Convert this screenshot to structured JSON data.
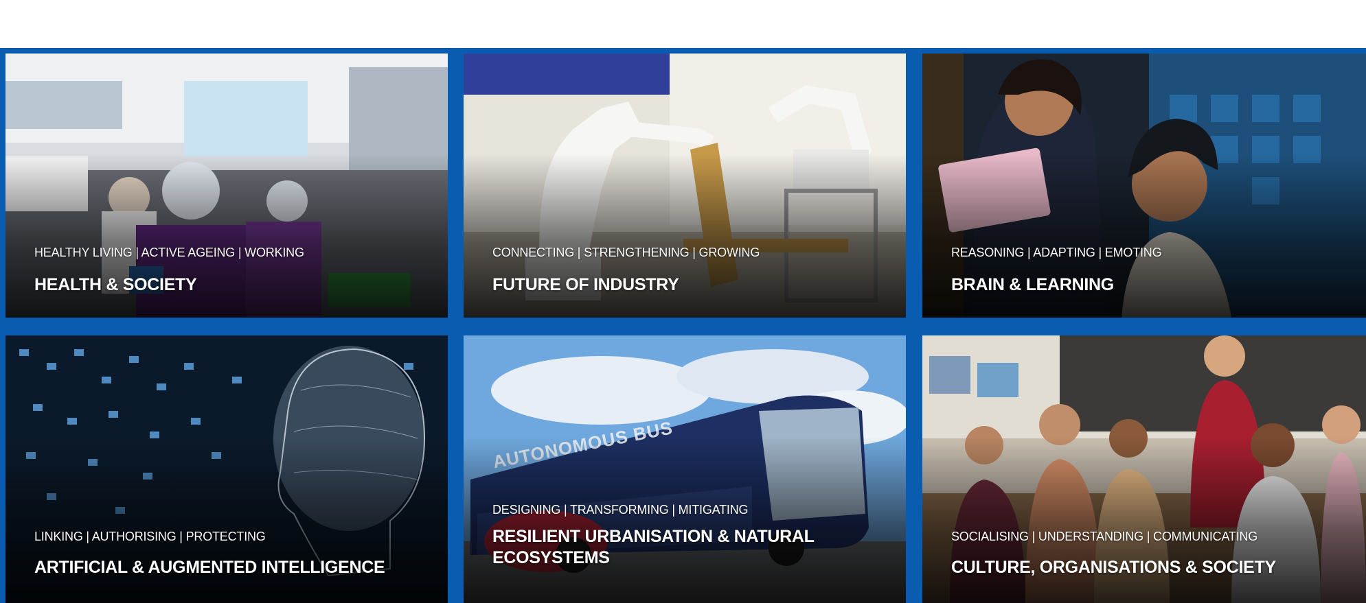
{
  "tiles": [
    {
      "subtitle": "HEALTHY LIVING | ACTIVE AGEING | WORKING",
      "title": "HEALTH & SOCIETY"
    },
    {
      "subtitle": "CONNECTING | STRENGTHENING | GROWING",
      "title": "FUTURE OF INDUSTRY"
    },
    {
      "subtitle": "REASONING | ADAPTING | EMOTING",
      "title": "BRAIN & LEARNING"
    },
    {
      "subtitle": "LINKING | AUTHORISING | PROTECTING",
      "title": "ARTIFICIAL & AUGMENTED INTELLIGENCE"
    },
    {
      "subtitle": "DESIGNING | TRANSFORMING | MITIGATING",
      "title": "RESILIENT URBANISATION & NATURAL ECOSYSTEMS"
    },
    {
      "subtitle": "SOCIALISING | UNDERSTANDING | COMMUNICATING",
      "title": "CULTURE, ORGANISATIONS & SOCIETY"
    }
  ],
  "bus_sign": "AUTONOMOUS BUS",
  "colors": {
    "frame": "#0a5cb0",
    "background": "#ffffff",
    "text": "#ffffff"
  }
}
